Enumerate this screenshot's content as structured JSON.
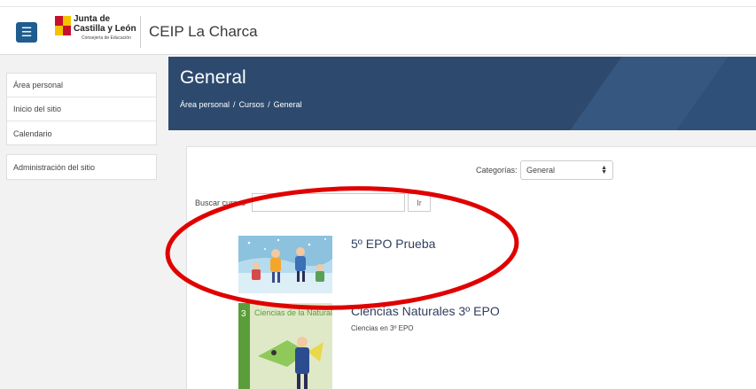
{
  "header": {
    "menu_icon": "hamburger-icon",
    "logo": {
      "line1": "Junta de",
      "line2": "Castilla y León",
      "line3": "Consejería de Educación"
    },
    "site_title": "CEIP La Charca"
  },
  "sidebar": {
    "items": [
      {
        "label": "Área personal"
      },
      {
        "label": "Inicio del sitio"
      },
      {
        "label": "Calendario"
      }
    ],
    "admin": {
      "label": "Administración del sitio"
    }
  },
  "page": {
    "title": "General",
    "breadcrumb": [
      "Área personal",
      "Cursos",
      "General"
    ],
    "breadcrumb_sep": "/"
  },
  "filters": {
    "category_label": "Categorías:",
    "category_value": "General",
    "search_label": "Buscar cursos",
    "search_value": "",
    "search_button": "Ir"
  },
  "courses": [
    {
      "name": "5º EPO Prueba",
      "summary": ""
    },
    {
      "name": "Ciencias Naturales 3º EPO",
      "summary": "Ciencias en 3º EPO",
      "cover_number": "3",
      "cover_title": "Ciencias de la Naturaleza"
    }
  ],
  "colors": {
    "banner": "#2d4a6e",
    "menu_button": "#1f5c8f",
    "annotation_circle": "#e00000"
  }
}
